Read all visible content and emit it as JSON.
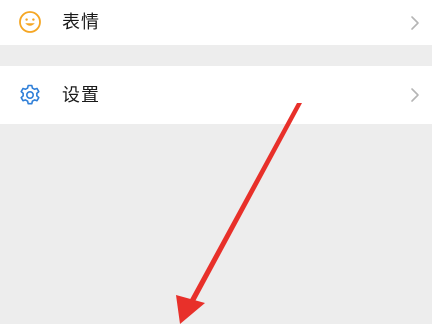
{
  "menu": {
    "items": [
      {
        "label": "表情",
        "icon": "smiley-icon",
        "icon_color": "#f5a623"
      },
      {
        "label": "设置",
        "icon": "gear-icon",
        "icon_color": "#2f7fd8"
      }
    ]
  },
  "annotation": {
    "arrow_color": "#e8302a"
  }
}
